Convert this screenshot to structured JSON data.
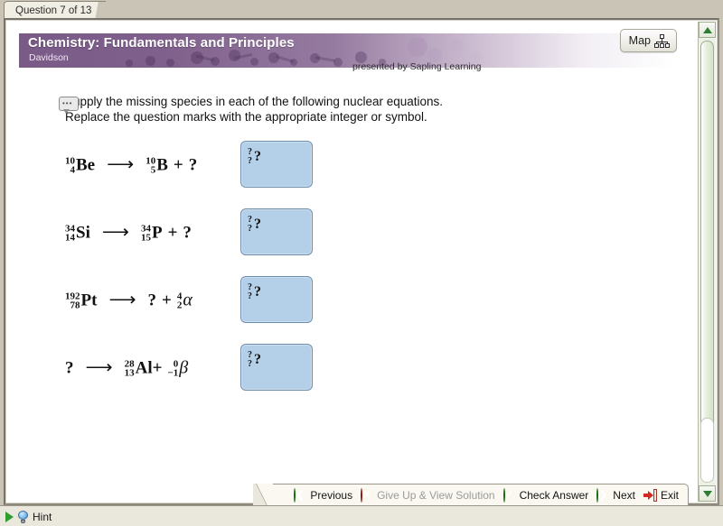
{
  "tab": {
    "label": "Question 7 of 13"
  },
  "banner": {
    "title": "Chemistry: Fundamentals and Principles",
    "author": "Davidson",
    "presented_by": "presented by Sapling Learning",
    "accent_color": "#7a5a87"
  },
  "map_button": {
    "label": "Map",
    "icon": "sitemap-icon"
  },
  "question": {
    "icon": "comment-bubble-icon",
    "line1": "Supply the missing species in each of the following nuclear equations.",
    "line2": "Replace the question marks with the appropriate integer or symbol."
  },
  "equations": [
    {
      "reactant": {
        "mass": "10",
        "atomic": "4",
        "symbol": "Be"
      },
      "arrow": "⟶",
      "product": {
        "mass": "10",
        "atomic": "5",
        "symbol": "B"
      },
      "plus": "+",
      "unknown": "?",
      "answer": {
        "mass": "?",
        "atomic": "?",
        "symbol": "?"
      }
    },
    {
      "reactant": {
        "mass": "34",
        "atomic": "14",
        "symbol": "Si"
      },
      "arrow": "⟶",
      "product": {
        "mass": "34",
        "atomic": "15",
        "symbol": "P"
      },
      "plus": "+",
      "unknown": "?",
      "answer": {
        "mass": "?",
        "atomic": "?",
        "symbol": "?"
      }
    },
    {
      "reactant": {
        "mass": "192",
        "atomic": "78",
        "symbol": "Pt"
      },
      "arrow": "⟶",
      "unknown_first": "?",
      "plus": "+",
      "product": {
        "mass": "4",
        "atomic": "2",
        "symbol": "α"
      },
      "answer": {
        "mass": "?",
        "atomic": "?",
        "symbol": "?"
      }
    },
    {
      "unknown_reactant": "?",
      "arrow": "⟶",
      "product": {
        "mass": "28",
        "atomic": "13",
        "symbol": "Al"
      },
      "plus": "+",
      "particle": {
        "mass": "0",
        "atomic": "−1",
        "symbol": "β"
      },
      "answer": {
        "mass": "?",
        "atomic": "?",
        "symbol": "?"
      }
    }
  ],
  "hint": {
    "label": "Hint",
    "icon": "lightbulb-icon"
  },
  "actions": [
    {
      "label": "Previous",
      "icon": "arrow-left-circle-icon",
      "state": "enabled"
    },
    {
      "label": "Give Up & View Solution",
      "icon": "x-circle-icon",
      "state": "disabled"
    },
    {
      "label": "Check Answer",
      "icon": "check-circle-icon",
      "state": "enabled"
    },
    {
      "label": "Next",
      "icon": "arrow-right-circle-icon",
      "state": "enabled"
    },
    {
      "label": "Exit",
      "icon": "exit-door-icon",
      "state": "enabled"
    }
  ]
}
